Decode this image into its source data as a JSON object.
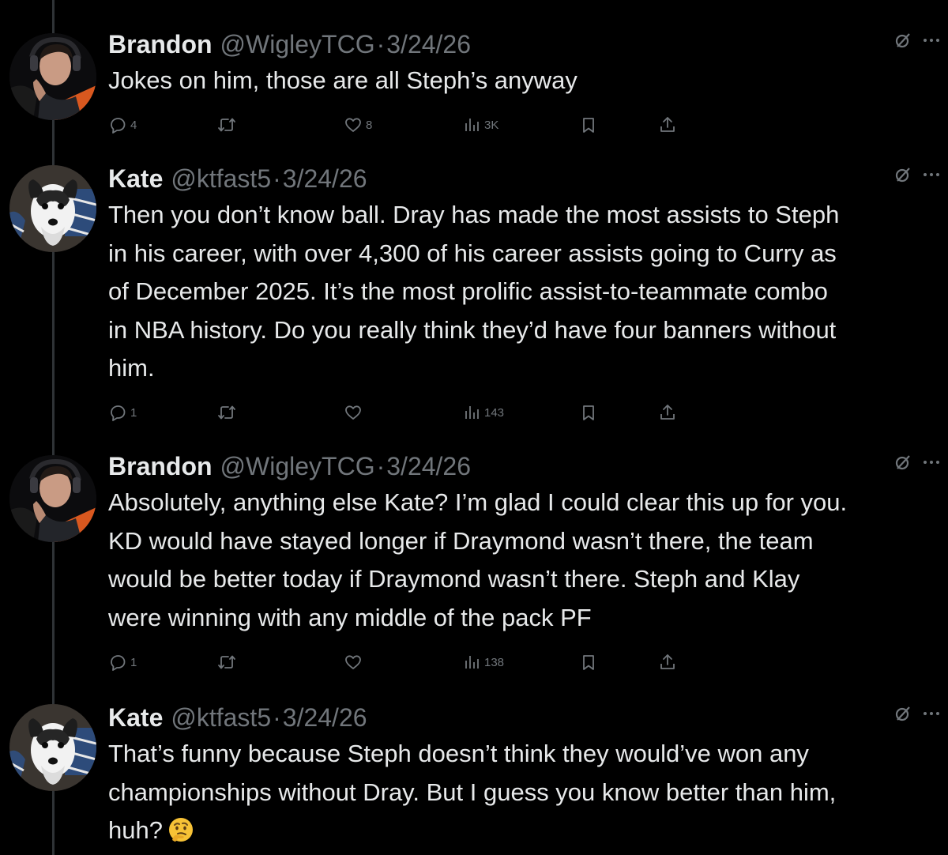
{
  "tweets": [
    {
      "name": "Brandon",
      "handle": "@WigleyTCG",
      "separator": "·",
      "date": "3/24/26",
      "lines": [
        "Jokes on him, those are all Steph’s anyway"
      ],
      "replies": "4",
      "retweets": "",
      "likes": "8",
      "views": "3K",
      "avatar": "man-with-headset"
    },
    {
      "name": "Kate",
      "handle": "@ktfast5",
      "separator": "·",
      "date": "3/24/26",
      "lines": [
        "Then you don’t know ball. Dray has made the most assists to Steph",
        "in his career, with over 4,300 of his career assists going to Curry as",
        "of December 2025. It’s the most prolific assist-to-teammate combo",
        "in NBA history. Do you really think they’d have four banners without",
        "him."
      ],
      "replies": "1",
      "retweets": "",
      "likes": "",
      "views": "143",
      "avatar": "black-white-dog"
    },
    {
      "name": "Brandon",
      "handle": "@WigleyTCG",
      "separator": "·",
      "date": "3/24/26",
      "lines": [
        "Absolutely, anything else Kate? I’m glad I could clear this up for you.",
        "KD would have stayed longer if Draymond wasn’t there, the team",
        "would be better today if Draymond wasn’t there. Steph and Klay",
        "were winning with any middle of the pack PF"
      ],
      "replies": "1",
      "retweets": "",
      "likes": "",
      "views": "138",
      "avatar": "man-with-headset"
    },
    {
      "name": "Kate",
      "handle": "@ktfast5",
      "separator": "·",
      "date": "3/24/26",
      "lines": [
        "That’s funny because Steph doesn’t think they would’ve won any",
        "championships without Dray. But I guess you know better than him,",
        "huh?"
      ],
      "trailing_emoji": "thinking-face-emoji",
      "avatar": "black-white-dog"
    }
  ],
  "colors": {
    "background": "#000000",
    "text": "#e7e9ea",
    "muted": "#71767b",
    "thread_line": "#2f3336"
  }
}
